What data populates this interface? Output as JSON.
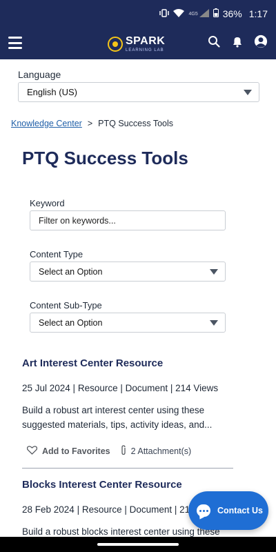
{
  "status_bar": {
    "battery": "36%",
    "time": "1:17",
    "network": "4G5"
  },
  "header": {
    "logo_word": "SPARK",
    "logo_sub": "LEARNING LAB"
  },
  "language": {
    "label": "Language",
    "value": "English (US)"
  },
  "breadcrumb": {
    "link": "Knowledge Center",
    "separator": ">",
    "current": "PTQ Success Tools"
  },
  "page_title": "PTQ Success Tools",
  "filters": {
    "keyword_label": "Keyword",
    "keyword_placeholder": "Filter on keywords...",
    "content_type_label": "Content Type",
    "content_type_value": "Select an Option",
    "content_subtype_label": "Content Sub-Type",
    "content_subtype_value": "Select an Option"
  },
  "results": [
    {
      "title": "Art Interest Center Resource",
      "meta": "25 Jul 2024 | Resource | Document | 214 Views",
      "desc_line1": "Build a robust art interest center using these",
      "desc_line2": "suggested materials, tips, activity ideas, and...",
      "favorites": "Add to Favorites",
      "attachments": "2 Attachment(s)"
    },
    {
      "title": "Blocks Interest Center Resource",
      "meta": "28 Feb 2024 | Resource | Document | 21",
      "desc_line1": "Build a robust blocks interest center using these"
    }
  ],
  "contact": {
    "label": "Contact Us"
  },
  "colors": {
    "header_bg": "#1e2b5a",
    "title": "#1e2b5a",
    "link": "#1f5fa8",
    "contact_bg": "#1f6ed4"
  }
}
